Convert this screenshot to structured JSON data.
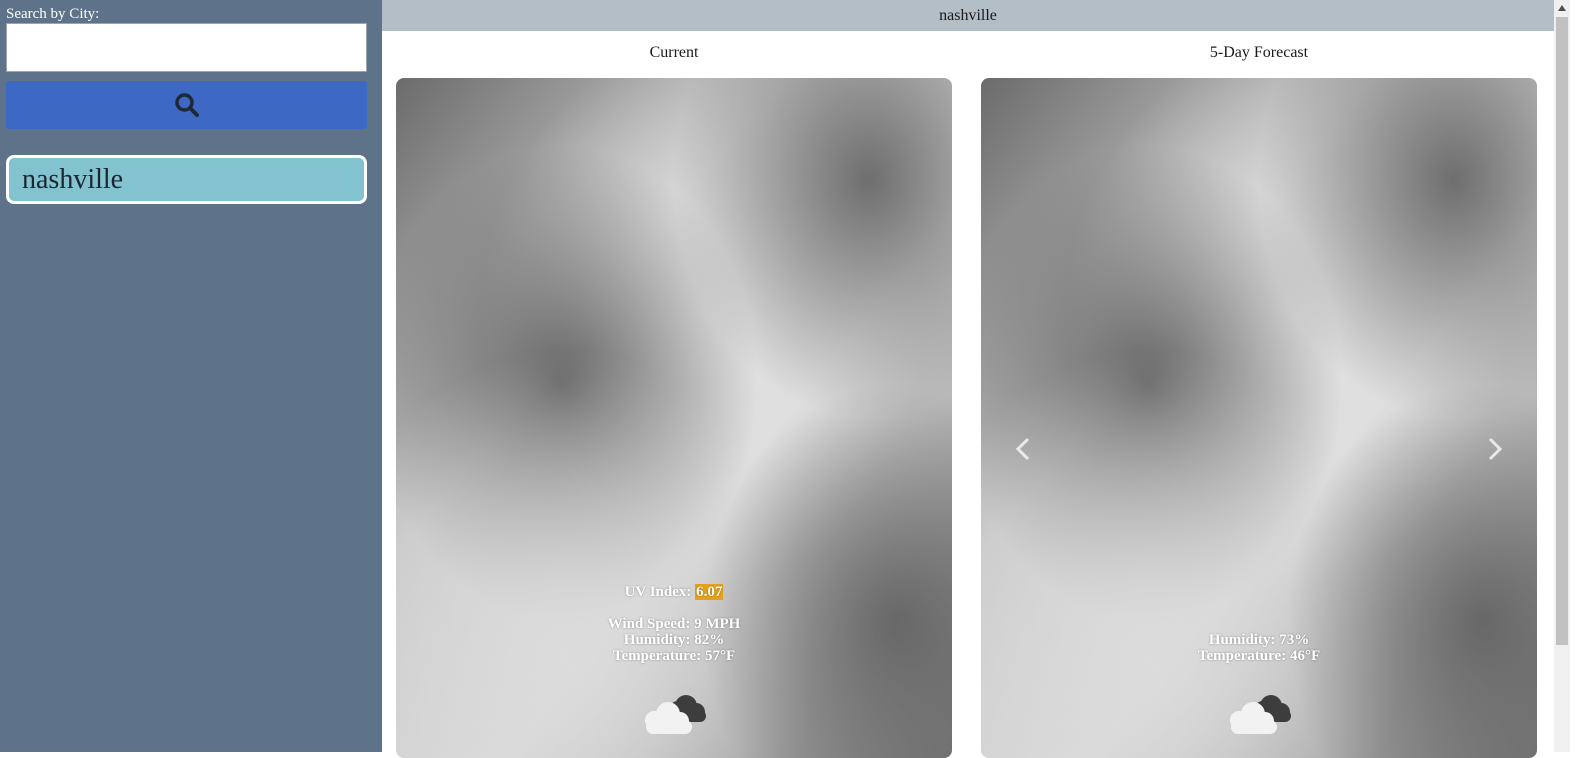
{
  "sidebar": {
    "search_label": "Search by City:",
    "search_value": "",
    "search_placeholder": "",
    "search_button_icon": "search-icon",
    "history": [
      {
        "label": "nashville"
      }
    ]
  },
  "header": {
    "city": "nashville"
  },
  "current": {
    "heading": "Current",
    "uv_label": "UV Index: ",
    "uv_value": "6.07",
    "wind": "Wind Speed: 9 MPH",
    "humidity": "Humidity: 82%",
    "temperature": "Temperature: 57°F",
    "icon": "cloudy-icon"
  },
  "forecast": {
    "heading": "5-Day Forecast",
    "humidity": "Humidity: 73%",
    "temperature": "Temperature: 46°F",
    "icon": "cloudy-icon",
    "prev_icon": "chevron-left-icon",
    "next_icon": "chevron-right-icon"
  },
  "colors": {
    "sidebar_bg": "#5e7389",
    "search_button": "#3d68c4",
    "history_item": "#82c3cf",
    "topbar": "#b3bec7",
    "uv_highlight": "#e6a11c"
  }
}
